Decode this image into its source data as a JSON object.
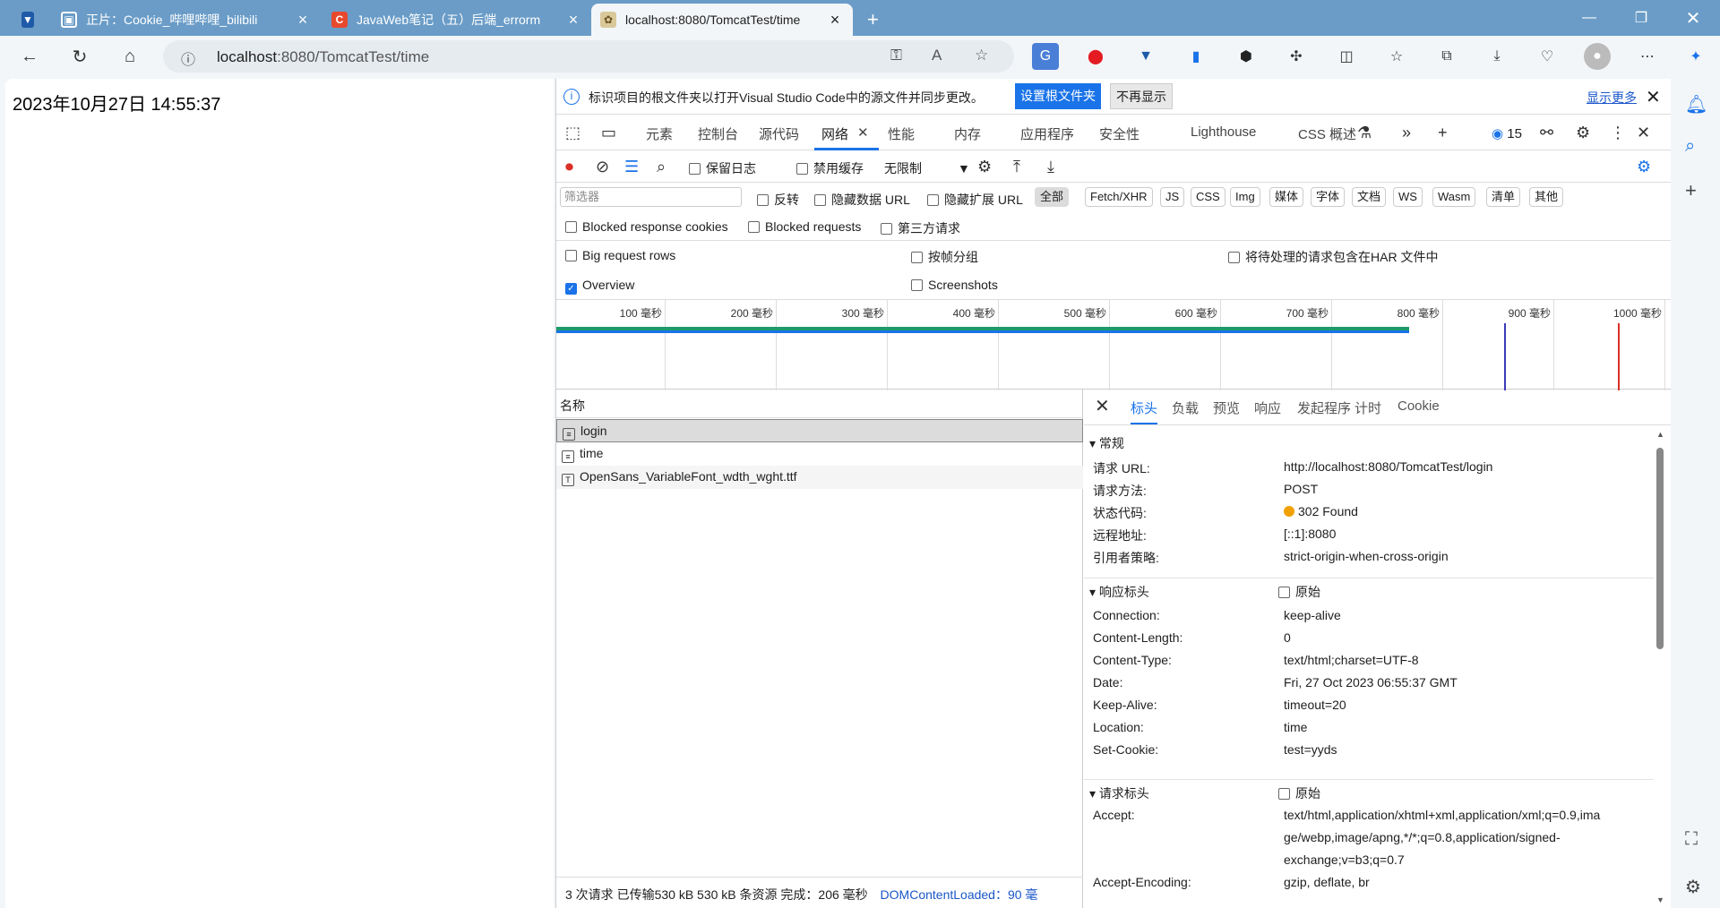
{
  "tabs": [
    {
      "title": "",
      "icon": "edge-pinned-icon"
    },
    {
      "title": "正片：Cookie_哔哩哔哩_bilibili",
      "icon": "bilibili-icon"
    },
    {
      "title": "JavaWeb笔记（五）后端_errorm",
      "icon": "csdn-icon"
    },
    {
      "title": "localhost:8080/TomcatTest/time",
      "icon": "tomcat-icon"
    }
  ],
  "address": {
    "host": "localhost",
    "rest": ":8080/TomcatTest/time"
  },
  "page": {
    "time_text": "2023年10月27日 14:55:37"
  },
  "devtools": {
    "infobar": {
      "message": "标识项目的根文件夹以打开Visual Studio Code中的源文件并同步更改。",
      "btn_set": "设置根文件夹",
      "btn_never": "不再显示",
      "more": "显示更多"
    },
    "tabs": [
      "元素",
      "控制台",
      "源代码",
      "网络",
      "性能",
      "内存",
      "应用程序",
      "安全性",
      "Lighthouse",
      "CSS 概述"
    ],
    "issues_count": "15",
    "throttle": "无限制",
    "network_checks": {
      "preserve_log": "保留日志",
      "disable_cache": "禁用缓存"
    },
    "filter": {
      "placeholder": "筛选器",
      "invert": "反转",
      "hide_data": "隐藏数据 URL",
      "hide_ext": "隐藏扩展 URL"
    },
    "chips": [
      "全部",
      "Fetch/XHR",
      "JS",
      "CSS",
      "Img",
      "媒体",
      "字体",
      "文档",
      "WS",
      "Wasm",
      "清单",
      "其他"
    ],
    "opts1": [
      "Blocked response cookies",
      "Blocked requests",
      "第三方请求"
    ],
    "opts2": [
      "Big request rows",
      "按帧分组",
      "将待处理的请求包含在HAR 文件中"
    ],
    "opts3": [
      "Overview",
      "Screenshots"
    ],
    "ticks": [
      "100 毫秒",
      "200 毫秒",
      "300 毫秒",
      "400 毫秒",
      "500 毫秒",
      "600 毫秒",
      "700 毫秒",
      "800 毫秒",
      "900 毫秒",
      "1000 毫秒"
    ],
    "list_header": "名称",
    "requests": [
      "login",
      "time",
      "OpenSans_VariableFont_wdth_wght.ttf"
    ],
    "status_bar": "3 次请求  已传输530 kB  530 kB 条资源  完成：206 毫秒",
    "status_dcl": "DOMContentLoaded：90 毫",
    "detail_tabs": [
      "标头",
      "负载",
      "预览",
      "响应",
      "发起程序",
      "计时",
      "Cookie"
    ],
    "general_title": "常规",
    "general": [
      {
        "k": "请求 URL:",
        "v": "http://localhost:8080/TomcatTest/login"
      },
      {
        "k": "请求方法:",
        "v": "POST"
      },
      {
        "k": "状态代码:",
        "v": "302 Found"
      },
      {
        "k": "远程地址:",
        "v": "[::1]:8080"
      },
      {
        "k": "引用者策略:",
        "v": "strict-origin-when-cross-origin"
      }
    ],
    "resp_title": "响应标头",
    "raw_label": "原始",
    "resp": [
      {
        "k": "Connection:",
        "v": "keep-alive"
      },
      {
        "k": "Content-Length:",
        "v": "0"
      },
      {
        "k": "Content-Type:",
        "v": "text/html;charset=UTF-8"
      },
      {
        "k": "Date:",
        "v": "Fri, 27 Oct 2023 06:55:37 GMT"
      },
      {
        "k": "Keep-Alive:",
        "v": "timeout=20"
      },
      {
        "k": "Location:",
        "v": "time"
      },
      {
        "k": "Set-Cookie:",
        "v": "test=yyds"
      }
    ],
    "req_title": "请求标头",
    "req": [
      {
        "k": "Accept:",
        "v1": "text/html,application/xhtml+xml,application/xml;q=0.9,ima",
        "v2": "ge/webp,image/apng,*/*;q=0.8,application/signed-",
        "v3": "exchange;v=b3;q=0.7"
      },
      {
        "k": "Accept-Encoding:",
        "v": "gzip, deflate, br"
      }
    ]
  },
  "colors": {
    "accent": "#1a73e8",
    "status_dot": "#f0a000",
    "tab_strip": "#6a9cc7"
  }
}
